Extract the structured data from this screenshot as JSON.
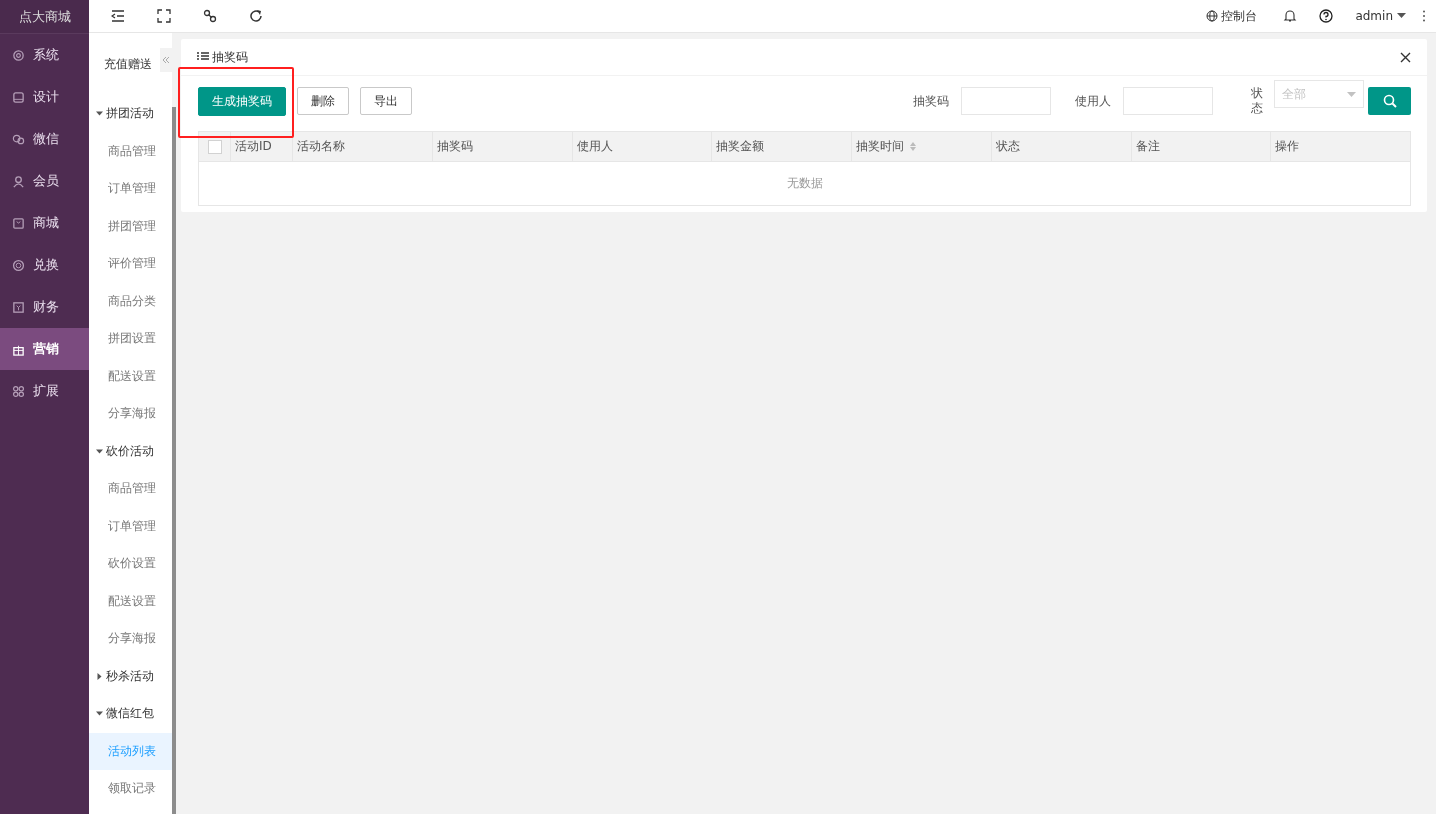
{
  "brand": "点大商城",
  "main_nav": [
    {
      "label": "系统",
      "selected": false
    },
    {
      "label": "设计",
      "selected": false
    },
    {
      "label": "微信",
      "selected": false
    },
    {
      "label": "会员",
      "selected": false
    },
    {
      "label": "商城",
      "selected": false
    },
    {
      "label": "兑换",
      "selected": false
    },
    {
      "label": "财务",
      "selected": false
    },
    {
      "label": "营销",
      "selected": true
    },
    {
      "label": "扩展",
      "selected": false
    }
  ],
  "sub_nav": {
    "title": "充值赠送",
    "groups": [
      {
        "label": "拼团活动",
        "expanded": true,
        "items": [
          {
            "label": "商品管理",
            "selected": false
          },
          {
            "label": "订单管理",
            "selected": false
          },
          {
            "label": "拼团管理",
            "selected": false
          },
          {
            "label": "评价管理",
            "selected": false
          },
          {
            "label": "商品分类",
            "selected": false
          },
          {
            "label": "拼团设置",
            "selected": false
          },
          {
            "label": "配送设置",
            "selected": false
          },
          {
            "label": "分享海报",
            "selected": false
          }
        ]
      },
      {
        "label": "砍价活动",
        "expanded": true,
        "items": [
          {
            "label": "商品管理",
            "selected": false
          },
          {
            "label": "订单管理",
            "selected": false
          },
          {
            "label": "砍价设置",
            "selected": false
          },
          {
            "label": "配送设置",
            "selected": false
          },
          {
            "label": "分享海报",
            "selected": false
          }
        ]
      },
      {
        "label": "秒杀活动",
        "expanded": false
      },
      {
        "label": "微信红包",
        "expanded": true,
        "items": [
          {
            "label": "活动列表",
            "selected": true
          },
          {
            "label": "领取记录",
            "selected": false
          }
        ]
      }
    ]
  },
  "topbar": {
    "console": "控制台",
    "user": "admin"
  },
  "panel": {
    "title": "抽奖码",
    "buttons": [
      {
        "label": "生成抽奖码",
        "kind": "primary",
        "highlighted": true
      },
      {
        "label": "删除",
        "kind": "plain",
        "highlighted": false
      },
      {
        "label": "导出",
        "kind": "plain",
        "highlighted": false
      }
    ],
    "filters": [
      {
        "label": "抽奖码",
        "kind": "input"
      },
      {
        "label": "使用人",
        "kind": "input"
      },
      {
        "label": "状态",
        "kind": "select",
        "placeholder": "全部"
      }
    ],
    "table": {
      "all_checked": false,
      "columns": [
        {
          "label": "活动ID",
          "sortable": false
        },
        {
          "label": "活动名称",
          "sortable": false
        },
        {
          "label": "抽奖码",
          "sortable": false
        },
        {
          "label": "使用人",
          "sortable": false
        },
        {
          "label": "抽奖金额",
          "sortable": false
        },
        {
          "label": "抽奖时间",
          "sortable": true
        },
        {
          "label": "状态",
          "sortable": false
        },
        {
          "label": "备注",
          "sortable": false
        },
        {
          "label": "操作",
          "sortable": false
        }
      ],
      "empty_text": "无数据"
    }
  }
}
